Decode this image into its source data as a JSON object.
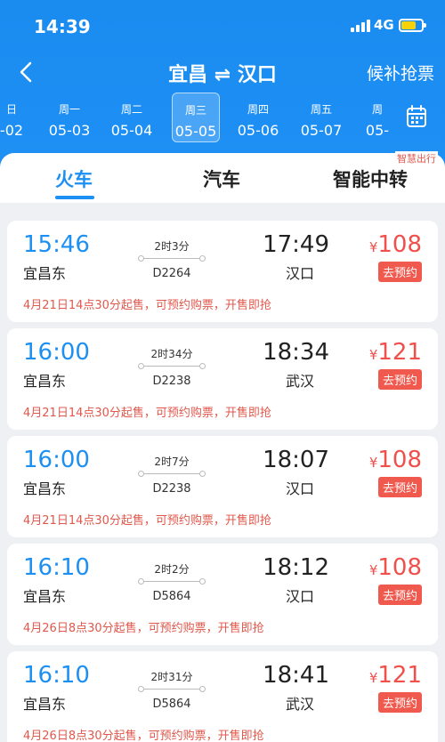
{
  "status": {
    "time": "14:39",
    "network": "4G"
  },
  "nav": {
    "title": "宜昌 ⇌ 汉口",
    "waitlist": "候补抢票"
  },
  "dates": [
    {
      "weekday": "日",
      "date": "-02"
    },
    {
      "weekday": "周一",
      "date": "05-03"
    },
    {
      "weekday": "周二",
      "date": "05-04"
    },
    {
      "weekday": "周三",
      "date": "05-05"
    },
    {
      "weekday": "周四",
      "date": "05-06"
    },
    {
      "weekday": "周五",
      "date": "05-07"
    },
    {
      "weekday": "周",
      "date": "05-"
    }
  ],
  "selected_date_index": 3,
  "tabs": [
    "火车",
    "汽车",
    "智能中转"
  ],
  "smart_badge": "智慧出行",
  "trains": [
    {
      "dep_time": "15:46",
      "dep_station": "宜昌东",
      "duration": "2时3分",
      "train_no": "D2264",
      "arr_time": "17:49",
      "arr_station": "汉口",
      "currency": "¥",
      "price": "108",
      "action": "去预约",
      "note": "4月21日14点30分起售，可预约购票，开售即抢"
    },
    {
      "dep_time": "16:00",
      "dep_station": "宜昌东",
      "duration": "2时34分",
      "train_no": "D2238",
      "arr_time": "18:34",
      "arr_station": "武汉",
      "currency": "¥",
      "price": "121",
      "action": "去预约",
      "note": "4月21日14点30分起售，可预约购票，开售即抢"
    },
    {
      "dep_time": "16:00",
      "dep_station": "宜昌东",
      "duration": "2时7分",
      "train_no": "D2238",
      "arr_time": "18:07",
      "arr_station": "汉口",
      "currency": "¥",
      "price": "108",
      "action": "去预约",
      "note": "4月21日14点30分起售，可预约购票，开售即抢"
    },
    {
      "dep_time": "16:10",
      "dep_station": "宜昌东",
      "duration": "2时2分",
      "train_no": "D5864",
      "arr_time": "18:12",
      "arr_station": "汉口",
      "currency": "¥",
      "price": "108",
      "action": "去预约",
      "note": "4月26日8点30分起售，可预约购票，开售即抢"
    },
    {
      "dep_time": "16:10",
      "dep_station": "宜昌东",
      "duration": "2时31分",
      "train_no": "D5864",
      "arr_time": "18:41",
      "arr_station": "武汉",
      "currency": "¥",
      "price": "121",
      "action": "去预约",
      "note": "4月26日8点30分起售，可预约购票，开售即抢"
    }
  ],
  "colors": {
    "header": "#1a8cf0",
    "accent": "#1b8ff2",
    "price": "#f0504c"
  }
}
